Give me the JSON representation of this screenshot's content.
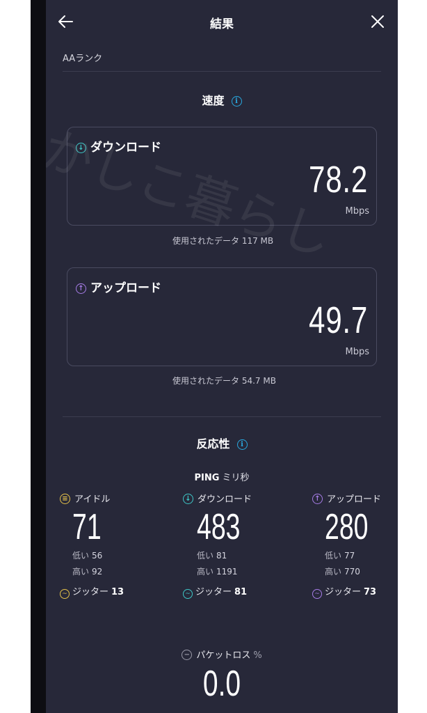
{
  "header": {
    "title": "結果"
  },
  "rank": "AAランク",
  "speed": {
    "section_title": "速度",
    "download": {
      "label": "ダウンロード",
      "value": "78.2",
      "unit": "Mbps",
      "data_used": "使用されたデータ 117 MB"
    },
    "upload": {
      "label": "アップロード",
      "value": "49.7",
      "unit": "Mbps",
      "data_used": "使用されたデータ 54.7 MB"
    }
  },
  "responsiveness": {
    "section_title": "反応性",
    "ping_label": "PING",
    "ping_unit": "ミリ秒",
    "columns": [
      {
        "label": "アイドル",
        "value": "71",
        "low_label": "低い",
        "low": "56",
        "high_label": "高い",
        "high": "92",
        "jitter_label": "ジッター",
        "jitter": "13"
      },
      {
        "label": "ダウンロード",
        "value": "483",
        "low_label": "低い",
        "low": "81",
        "high_label": "高い",
        "high": "1191",
        "jitter_label": "ジッター",
        "jitter": "81"
      },
      {
        "label": "アップロード",
        "value": "280",
        "low_label": "低い",
        "low": "77",
        "high_label": "高い",
        "high": "770",
        "jitter_label": "ジッター",
        "jitter": "73"
      }
    ],
    "packet_loss_label": "パケットロス",
    "packet_loss_unit": "%",
    "packet_loss_value": "0.0"
  },
  "watermark_text": "かしこ暮らし",
  "colors": {
    "background": "#272839",
    "download_accent": "#3ec8c8",
    "upload_accent": "#a77de8",
    "idle_accent": "#e6c24a",
    "info_accent": "#29a9e0"
  }
}
